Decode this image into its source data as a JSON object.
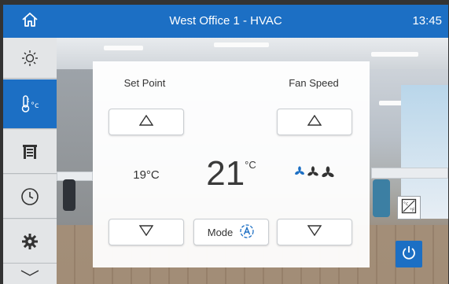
{
  "header": {
    "title": "West Office 1 - HVAC",
    "time": "13:45",
    "home_icon": "home-icon"
  },
  "sidebar": {
    "items": [
      {
        "icon": "lighting-icon",
        "active": false
      },
      {
        "icon": "thermometer-celsius-icon",
        "active": true
      },
      {
        "icon": "blinds-icon",
        "active": false
      },
      {
        "icon": "clock-icon",
        "active": false
      },
      {
        "icon": "gear-icon",
        "active": false
      }
    ],
    "more_icon": "chevron-down-icon"
  },
  "setpoint": {
    "label": "Set Point",
    "value": "19",
    "unit": "°C"
  },
  "current": {
    "temperature": "21",
    "unit": "°C"
  },
  "fan": {
    "label": "Fan Speed",
    "levels_total": 3,
    "level_active": 1
  },
  "mode": {
    "label": "Mode",
    "icon": "auto-mode-icon"
  },
  "controls": {
    "reverse_icon": "heat-cool-switch-icon",
    "power_icon": "power-icon"
  },
  "colors": {
    "accent": "#1c6fc4",
    "fan_active": "#1c6fc4",
    "fan_inactive": "#333333"
  }
}
